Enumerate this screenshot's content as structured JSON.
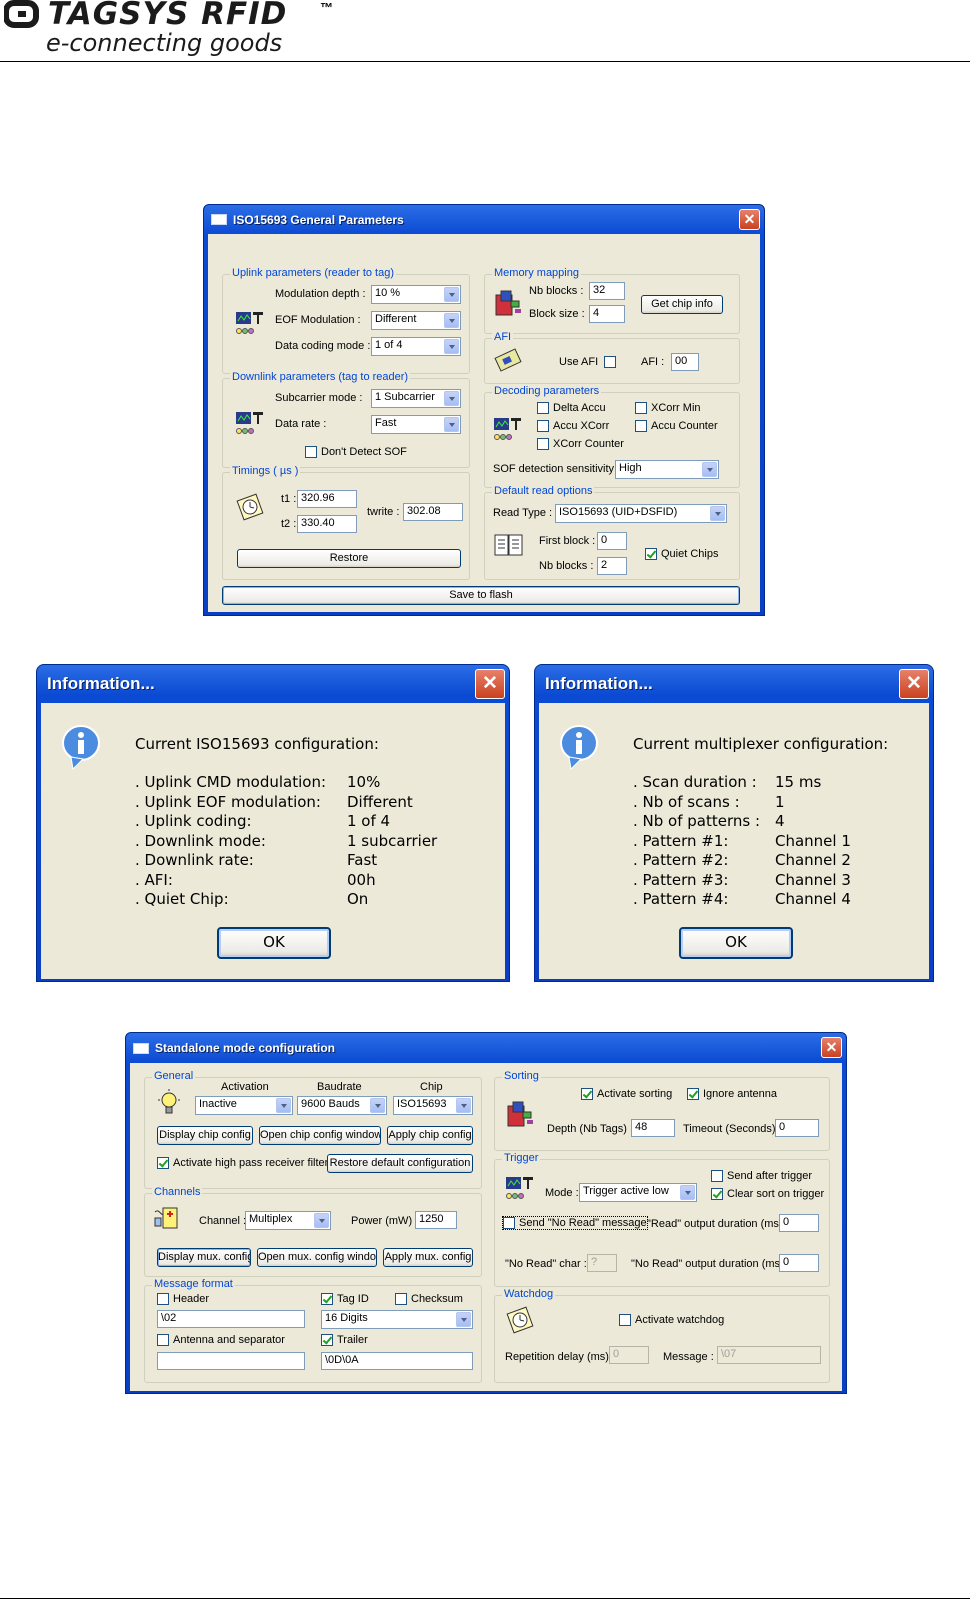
{
  "header": {
    "brand": "TAGSYS RFID",
    "tm": "™",
    "tagline": "e-connecting goods"
  },
  "iso_window": {
    "title": "ISO15693 General Parameters",
    "uplink": {
      "title": "Uplink parameters (reader to tag)",
      "modulation_depth_label": "Modulation depth :",
      "modulation_depth_value": "10 %",
      "eof_label": "EOF Modulation :",
      "eof_value": "Different",
      "coding_label": "Data coding mode :",
      "coding_value": "1 of 4"
    },
    "downlink": {
      "title": "Downlink parameters (tag to reader)",
      "subcarrier_label": "Subcarrier mode :",
      "subcarrier_value": "1 Subcarrier",
      "rate_label": "Data rate :",
      "rate_value": "Fast",
      "dont_detect_sof": "Don't Detect SOF"
    },
    "timings": {
      "title": "Timings ( µs )",
      "t1_label": "t1 :",
      "t1_value": "320.96",
      "t2_label": "t2 :",
      "t2_value": "330.40",
      "twrite_label": "twrite :",
      "twrite_value": "302.08",
      "restore": "Restore"
    },
    "memory": {
      "title": "Memory mapping",
      "nb_blocks_label": "Nb blocks :",
      "nb_blocks_value": "32",
      "block_size_label": "Block size :",
      "block_size_value": "4",
      "get_chip_info": "Get chip info"
    },
    "afi": {
      "title": "AFI",
      "use_afi": "Use AFI",
      "afi_label": "AFI :",
      "afi_value": "00"
    },
    "decoding": {
      "title": "Decoding parameters",
      "delta_accu": "Delta Accu",
      "xcorr_min": "XCorr Min",
      "accu_xcorr": "Accu XCorr",
      "accu_counter": "Accu Counter",
      "xcorr_counter": "XCorr Counter",
      "sof_label": "SOF detection sensitivity :",
      "sof_value": "High"
    },
    "read_options": {
      "title": "Default read options",
      "read_type_label": "Read Type :",
      "read_type_value": "ISO15693 (UID+DSFID)",
      "first_block_label": "First block :",
      "first_block_value": "0",
      "nb_blocks_label": "Nb blocks :",
      "nb_blocks_value": "2",
      "quiet_chips": "Quiet Chips"
    },
    "save_to_flash": "Save to flash"
  },
  "info1": {
    "title": "Information...",
    "heading": "Current ISO15693 configuration:",
    "rows": [
      {
        "k": ". Uplink CMD modulation:",
        "v": "10%"
      },
      {
        "k": ". Uplink EOF modulation:",
        "v": "Different"
      },
      {
        "k": ". Uplink coding:",
        "v": "1 of 4"
      },
      {
        "k": ". Downlink mode:",
        "v": "1 subcarrier"
      },
      {
        "k": ". Downlink rate:",
        "v": "Fast"
      },
      {
        "k": ". AFI:",
        "v": "00h"
      },
      {
        "k": ". Quiet Chip:",
        "v": "On"
      }
    ],
    "ok": "OK"
  },
  "info2": {
    "title": "Information...",
    "heading": "Current multiplexer configuration:",
    "rows": [
      {
        "k": ". Scan duration :",
        "v": "15 ms"
      },
      {
        "k": ". Nb of scans :",
        "v": "1"
      },
      {
        "k": ". Nb of patterns :",
        "v": "4"
      },
      {
        "k": ". Pattern #1:",
        "v": "Channel 1"
      },
      {
        "k": ". Pattern #2:",
        "v": "Channel 2"
      },
      {
        "k": ". Pattern #3:",
        "v": "Channel 3"
      },
      {
        "k": ". Pattern #4:",
        "v": "Channel 4"
      }
    ],
    "ok": "OK"
  },
  "standalone": {
    "title": "Standalone mode configuration",
    "general": {
      "title": "General",
      "activation_label": "Activation",
      "activation_value": "Inactive",
      "baudrate_label": "Baudrate",
      "baudrate_value": "9600 Bauds",
      "chip_label": "Chip",
      "chip_value": "ISO15693",
      "display_chip_config": "Display chip config",
      "open_chip_config_window": "Open chip config window",
      "apply_chip_config": "Apply chip config",
      "high_pass_filter": "Activate high pass receiver filter",
      "restore_default": "Restore default configuration"
    },
    "channels": {
      "title": "Channels",
      "channel_label": "Channel :",
      "channel_value": "Multiplex",
      "power_label": "Power (mW) :",
      "power_value": "1250",
      "display_mux": "Display mux. config",
      "open_mux": "Open mux. config window",
      "apply_mux": "Apply mux. config"
    },
    "message": {
      "title": "Message format",
      "header": "Header",
      "header_value": "\\02",
      "tag_id": "Tag ID",
      "tag_id_value": "16 Digits",
      "checksum": "Checksum",
      "antenna_sep": "Antenna and separator",
      "antenna_sep_value": "",
      "trailer": "Trailer",
      "trailer_value": "\\0D\\0A"
    },
    "sorting": {
      "title": "Sorting",
      "activate_sorting": "Activate sorting",
      "ignore_antenna": "Ignore antenna",
      "depth_label": "Depth (Nb Tags) :",
      "depth_value": "48",
      "timeout_label": "Timeout (Seconds) :",
      "timeout_value": "0"
    },
    "trigger": {
      "title": "Trigger",
      "mode_label": "Mode :",
      "mode_value": "Trigger active low",
      "send_after": "Send after trigger",
      "clear_sort": "Clear sort on trigger",
      "send_no_read": "Send \"No Read\" message",
      "read_duration_label": "\"Read\" output duration (ms) :",
      "read_duration_value": "0",
      "no_read_char_label": "\"No Read\" char :",
      "no_read_char_value": "?",
      "no_read_duration_label": "\"No Read\" output duration (ms) :",
      "no_read_duration_value": "0"
    },
    "watchdog": {
      "title": "Watchdog",
      "activate": "Activate watchdog",
      "rep_delay_label": "Repetition delay (ms) :",
      "rep_delay_value": "0",
      "message_label": "Message :",
      "message_value": "\\07"
    }
  }
}
